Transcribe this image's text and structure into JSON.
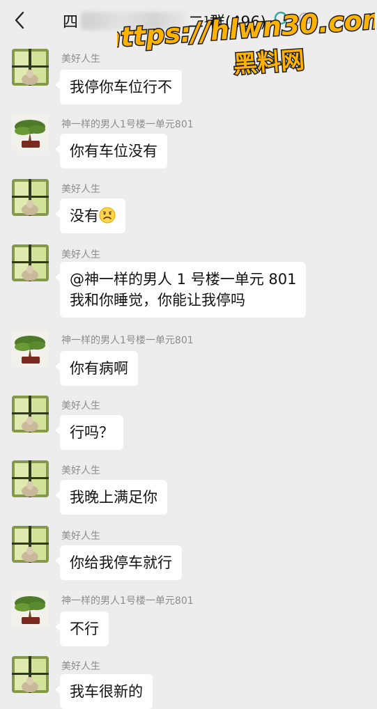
{
  "header": {
    "back_icon": "chevron-left-icon",
    "title_prefix": "四",
    "title_suffix": "二¹群(496)",
    "search_icon": "search-icon",
    "mute_icon": "bell-muted-icon"
  },
  "watermark": {
    "url": "https://hlwn30.com",
    "site": "黑料网"
  },
  "colors": {
    "background": "#ededed",
    "bubble": "#ffffff",
    "sender_name": "#8c8c8c",
    "watermark_fill": "#ffb300",
    "watermark_stroke": "#1a1a1a"
  },
  "messages": [
    {
      "sender": "美好人生",
      "avatar": "window-avatar",
      "text": "我停你车位行不"
    },
    {
      "sender": "神一样的男人1号楼一单元801",
      "avatar": "bonsai-avatar",
      "text": "你有车位没有"
    },
    {
      "sender": "美好人生",
      "avatar": "window-avatar",
      "text": "没有",
      "emoji": "frown-emoji"
    },
    {
      "sender": "美好人生",
      "avatar": "window-avatar",
      "text": "@神一样的男人 1 号楼一单元 801\n我和你睡觉，你能让我停吗"
    },
    {
      "sender": "神一样的男人1号楼一单元801",
      "avatar": "bonsai-avatar",
      "text": "你有病啊"
    },
    {
      "sender": "美好人生",
      "avatar": "window-avatar",
      "text": "行吗？"
    },
    {
      "sender": "美好人生",
      "avatar": "window-avatar",
      "text": "我晚上满足你"
    },
    {
      "sender": "美好人生",
      "avatar": "window-avatar",
      "text": "你给我停车就行"
    },
    {
      "sender": "神一样的男人1号楼一单元801",
      "avatar": "bonsai-avatar",
      "text": "不行"
    },
    {
      "sender": "美好人生",
      "avatar": "window-avatar",
      "text": "我车很新的"
    }
  ]
}
